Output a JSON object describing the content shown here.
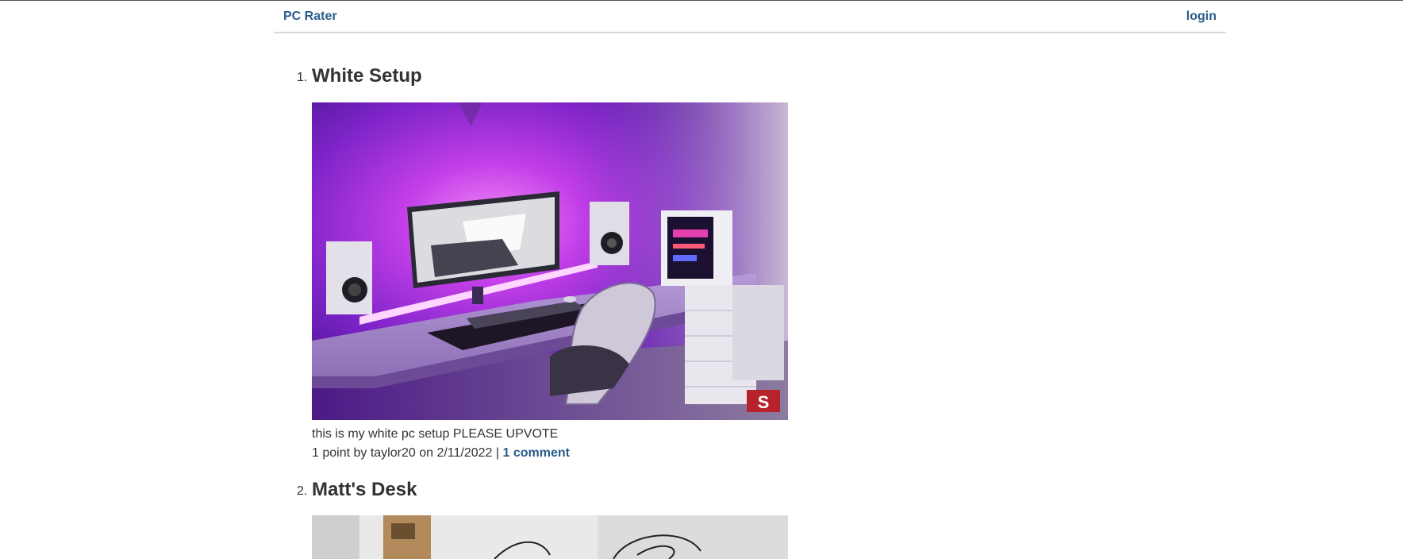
{
  "nav": {
    "brand": "PC Rater",
    "login": "login"
  },
  "posts": [
    {
      "number": "1.",
      "title": "White Setup",
      "description": "this is my white pc setup PLEASE UPVOTE",
      "meta_prefix": "1 point by taylor20 on 2/11/2022 | ",
      "comments_link": "1 comment",
      "image_alt": "white desk PC setup with purple lighting"
    },
    {
      "number": "2.",
      "title": "Matt's Desk",
      "image_alt": "desk photo"
    }
  ]
}
